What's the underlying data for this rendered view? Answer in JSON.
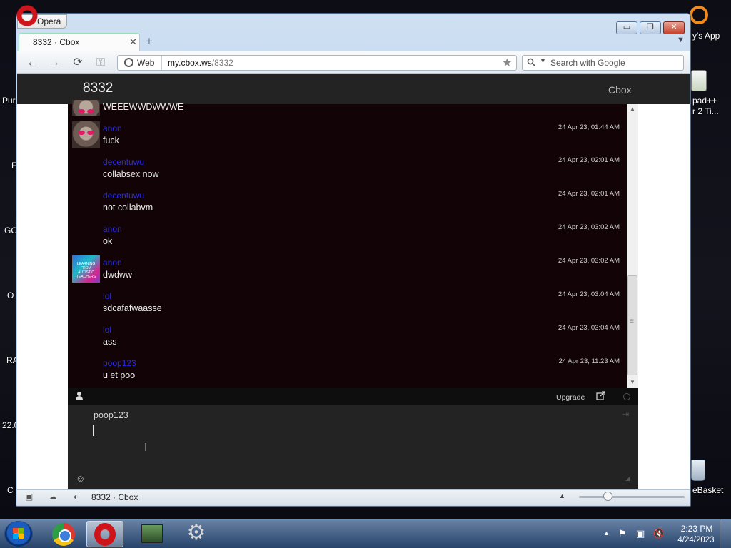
{
  "desktop": {
    "fragments": [
      {
        "id": "pur",
        "text": "Pur"
      },
      {
        "id": "f",
        "text": "F"
      },
      {
        "id": "gc",
        "text": "GC"
      },
      {
        "id": "o",
        "text": "O"
      },
      {
        "id": "ra",
        "text": "RA"
      },
      {
        "id": "n22",
        "text": "22.0"
      },
      {
        "id": "c",
        "text": "C"
      }
    ],
    "right_fragments": {
      "app": "y's App",
      "notepad1": "pad++",
      "notepad2": "r 2 Ti...",
      "basket": "eBasket"
    }
  },
  "window": {
    "opera_menu": "Opera",
    "controls": {
      "minimize": "▭",
      "maximize": "❐",
      "close": "✕"
    },
    "tab": {
      "title": "8332 · Cbox",
      "close": "✕",
      "add": "+"
    },
    "toolbar": {
      "back": "←",
      "forward": "→",
      "reload": "⟳",
      "key": "⚿",
      "web_label": "Web",
      "url_host": "my.cbox.ws",
      "url_path": "/8332",
      "star": "★",
      "search_placeholder": "Search with Google"
    }
  },
  "cbox": {
    "room": "8332",
    "brand": "Cbox",
    "partial_message": "WEEEWWDWWWE",
    "messages": [
      {
        "user": "anon",
        "text": "fuck",
        "time": "24 Apr 23, 01:44 AM",
        "avatar": "cat-avatar"
      },
      {
        "user": "decentuwu",
        "text": "collabsex now",
        "time": "24 Apr 23, 02:01 AM",
        "avatar": ""
      },
      {
        "user": "decentuwu",
        "text": "not collabvm",
        "time": "24 Apr 23, 02:01 AM",
        "avatar": ""
      },
      {
        "user": "anon",
        "text": "ok",
        "time": "24 Apr 23, 03:02 AM",
        "avatar": ""
      },
      {
        "user": "anon",
        "text": "dwdww",
        "time": "24 Apr 23, 03:02 AM",
        "avatar": "colorful-avatar"
      },
      {
        "user": "lol",
        "text": "sdcafafwaasse",
        "time": "24 Apr 23, 03:04 AM",
        "avatar": ""
      },
      {
        "user": "lol",
        "text": "ass",
        "time": "24 Apr 23, 03:04 AM",
        "avatar": ""
      },
      {
        "user": "poop123",
        "text": "u et poo",
        "time": "24 Apr 23, 11:23 AM",
        "avatar": ""
      }
    ],
    "upgrade": "Upgrade",
    "compose": {
      "name": "poop123",
      "value": ""
    }
  },
  "statusbar": {
    "title": "8332 · Cbox"
  },
  "taskbar": {
    "clock_time": "2:23 PM",
    "clock_date": "4/24/2023"
  },
  "colors": {
    "username": "#2b2bdc",
    "message_bg": "#120406",
    "header_bg": "#232323"
  }
}
